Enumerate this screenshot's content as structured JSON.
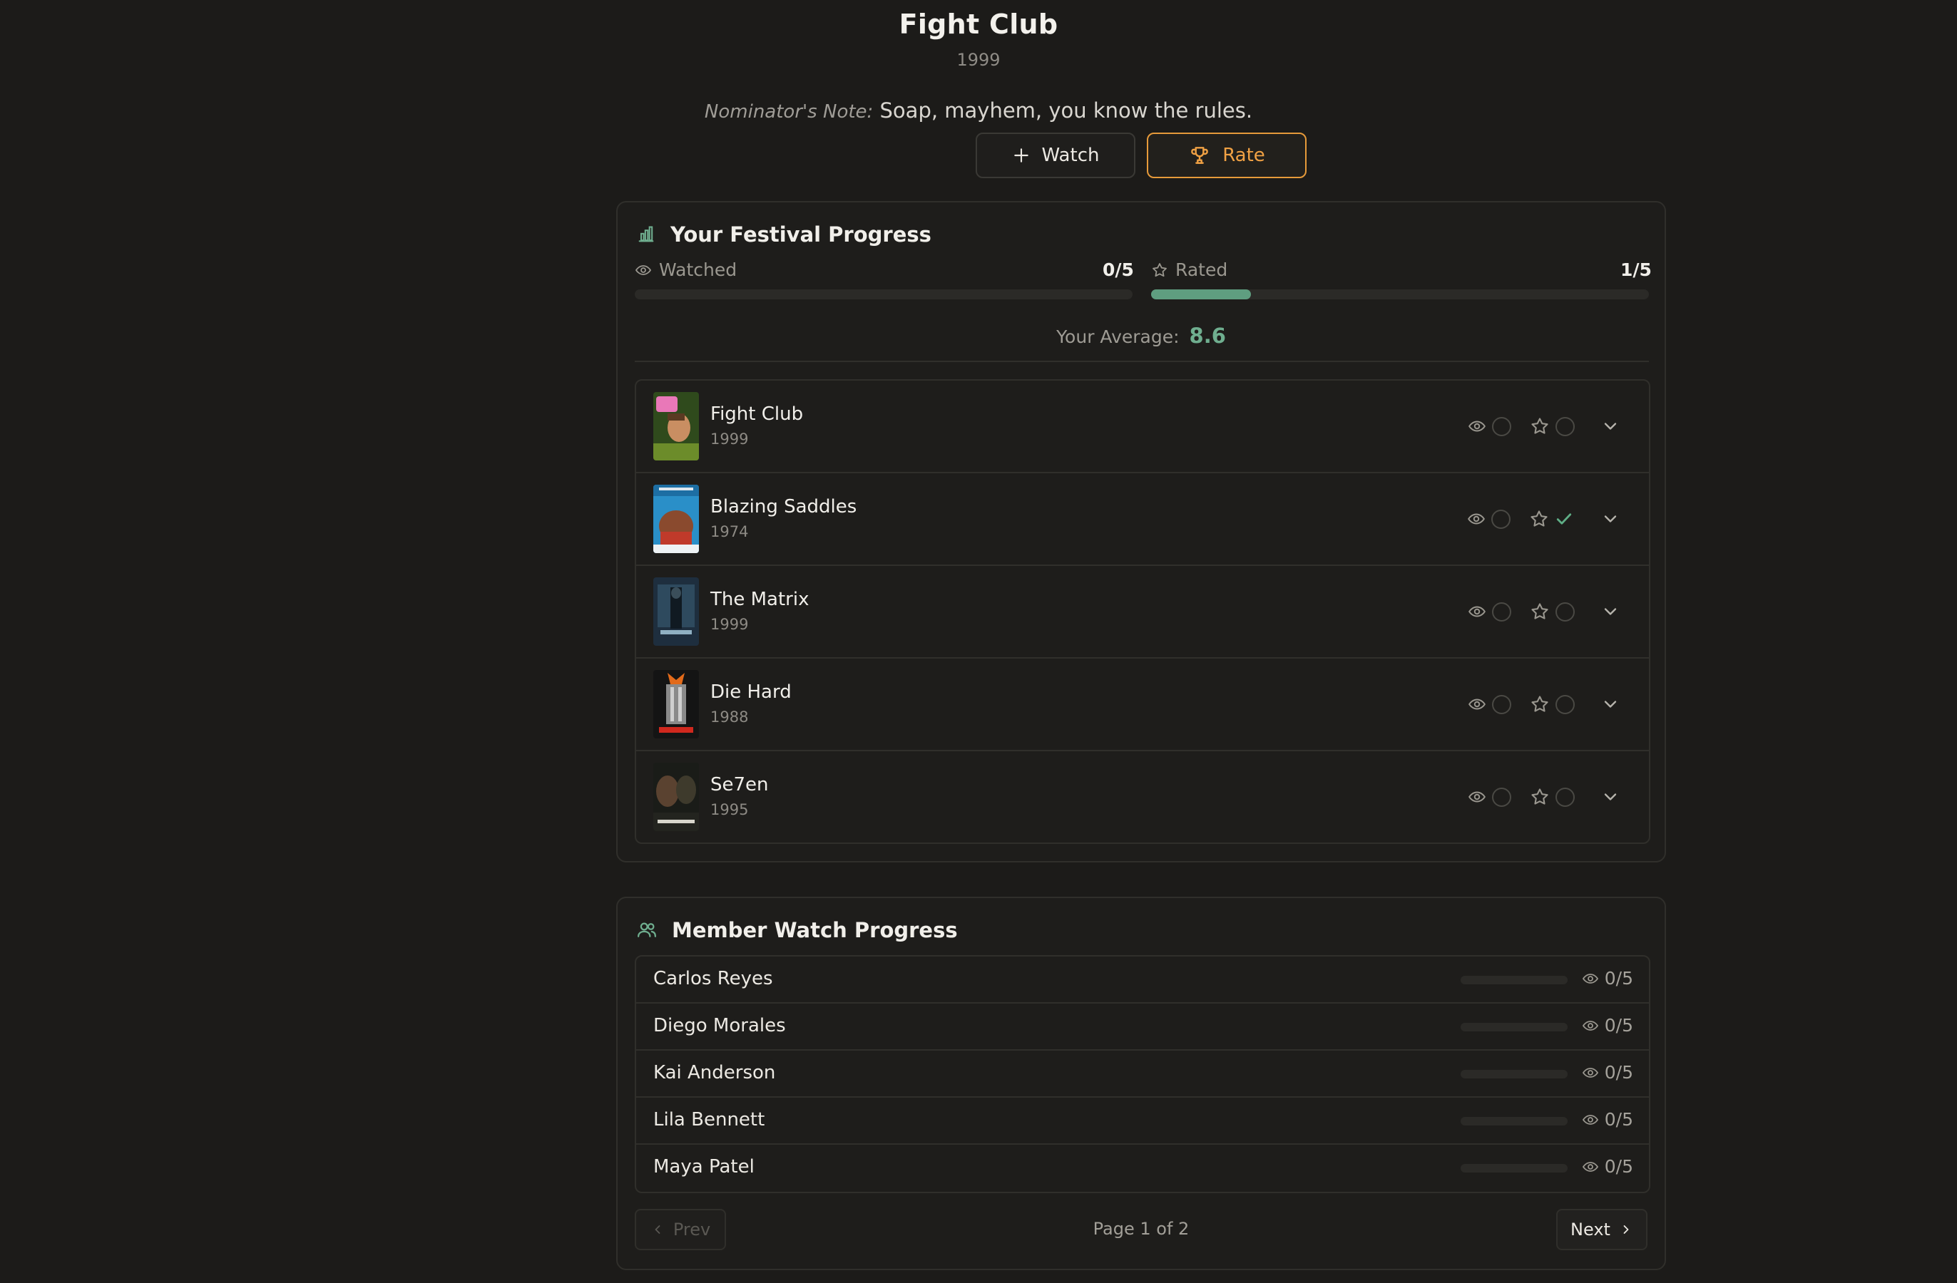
{
  "header": {
    "title": "Fight Club",
    "year": "1999",
    "note_label": "Nominator's Note:",
    "note_text": "Soap, mayhem, you know the rules."
  },
  "actions": {
    "watch_label": "Watch",
    "rate_label": "Rate",
    "watch_icon": "plus-icon",
    "rate_icon": "trophy-icon"
  },
  "progress": {
    "title": "Your Festival Progress",
    "icon": "bar-chart-icon",
    "watched_label": "Watched",
    "watched_count": "0/5",
    "watched_fraction": 0,
    "rated_label": "Rated",
    "rated_count": "1/5",
    "rated_fraction": 0.2,
    "average_label": "Your Average:",
    "average_value": "8.6"
  },
  "films": [
    {
      "title": "Fight Club",
      "year": "1999",
      "watched": false,
      "rated": false
    },
    {
      "title": "Blazing Saddles",
      "year": "1974",
      "watched": false,
      "rated": true
    },
    {
      "title": "The Matrix",
      "year": "1999",
      "watched": false,
      "rated": false
    },
    {
      "title": "Die Hard",
      "year": "1988",
      "watched": false,
      "rated": false
    },
    {
      "title": "Se7en",
      "year": "1995",
      "watched": false,
      "rated": false
    }
  ],
  "members": {
    "title": "Member Watch Progress",
    "icon": "users-icon",
    "list": [
      {
        "name": "Carlos Reyes",
        "count": "0/5",
        "fraction": 0
      },
      {
        "name": "Diego Morales",
        "count": "0/5",
        "fraction": 0
      },
      {
        "name": "Kai Anderson",
        "count": "0/5",
        "fraction": 0
      },
      {
        "name": "Lila Bennett",
        "count": "0/5",
        "fraction": 0
      },
      {
        "name": "Maya Patel",
        "count": "0/5",
        "fraction": 0
      }
    ],
    "prev_label": "Prev",
    "next_label": "Next",
    "page_text": "Page 1 of 2"
  },
  "colors": {
    "accent_green": "#5f9e80",
    "accent_orange": "#f0a144",
    "background": "#1c1b19"
  }
}
